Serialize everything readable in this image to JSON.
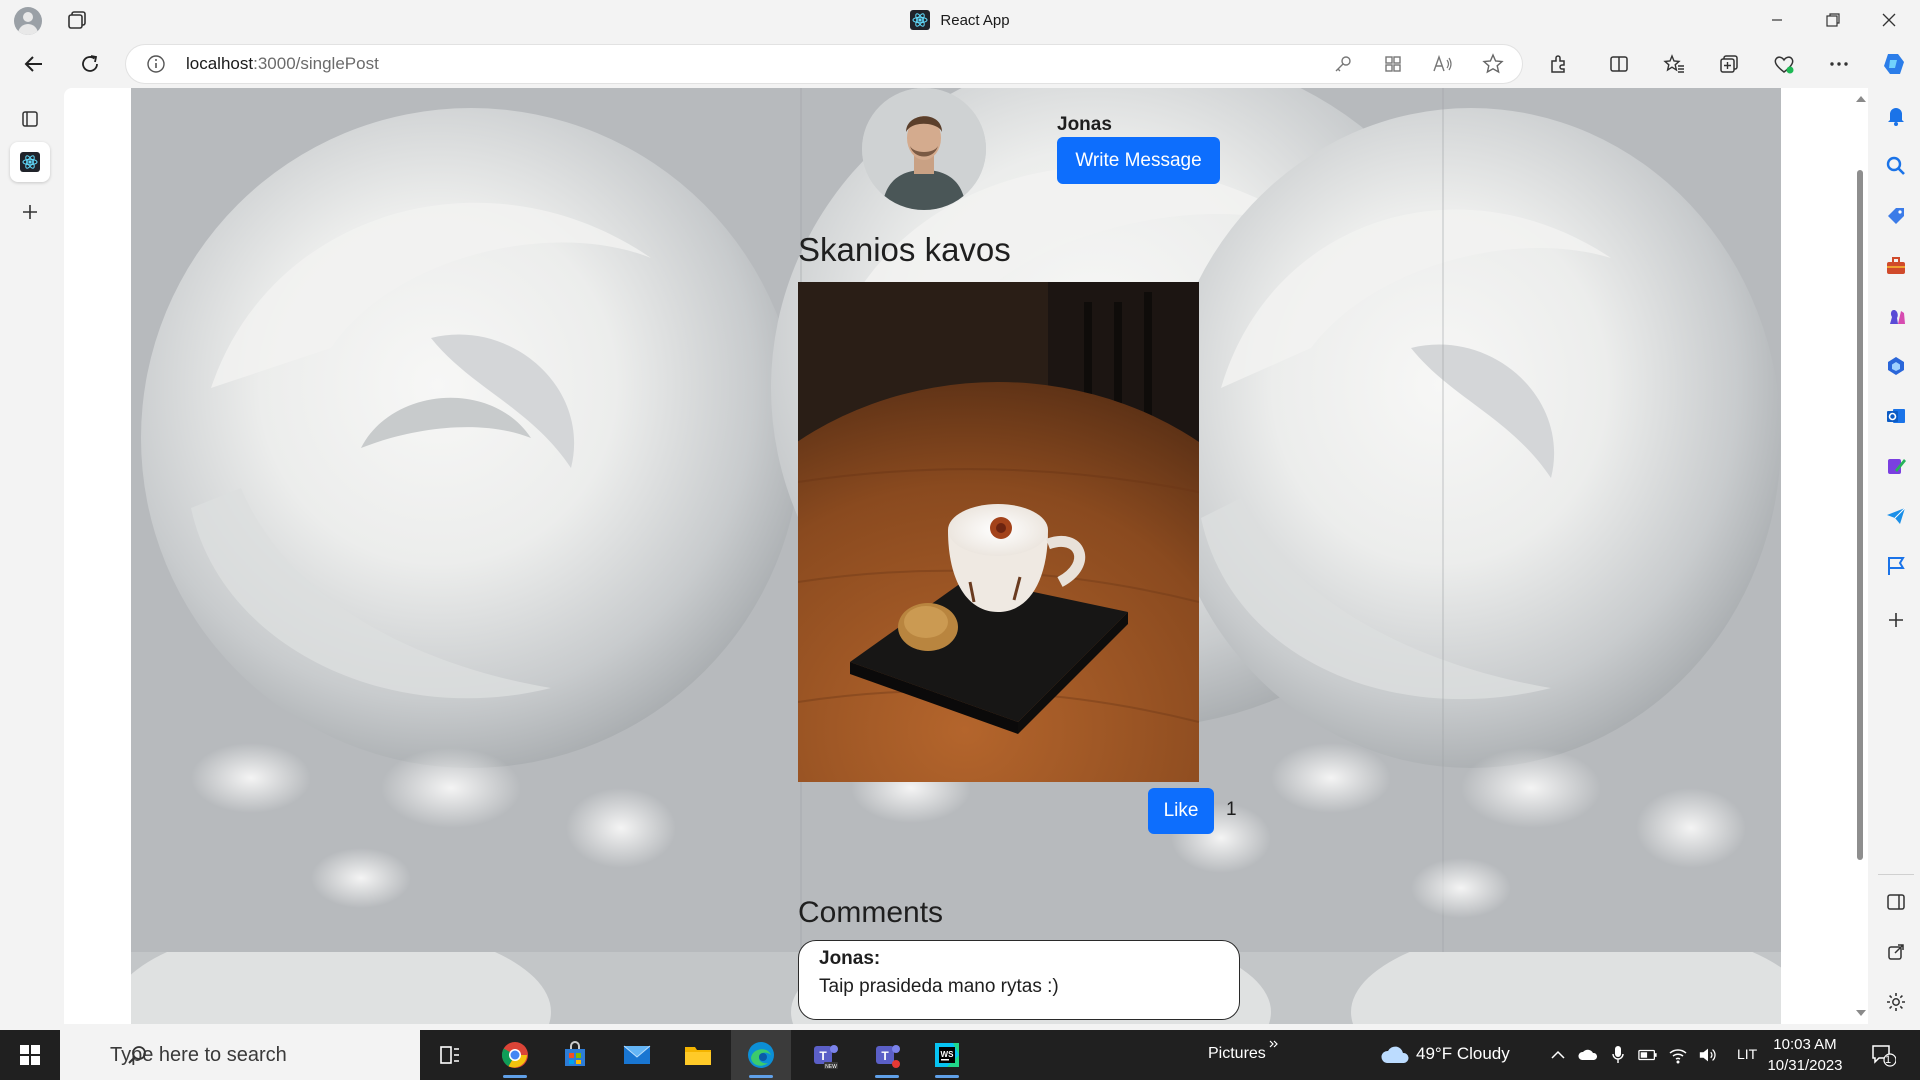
{
  "window": {
    "title": "React App"
  },
  "address_bar": {
    "url_host": "localhost",
    "url_path": ":3000/singlePost"
  },
  "post": {
    "author_name": "Jonas",
    "write_message_label": "Write Message",
    "title": "Skanios kavos",
    "like_label": "Like",
    "like_count": "1",
    "comments_title": "Comments",
    "comments": [
      {
        "author": "Jonas:",
        "text": "Taip prasideda mano rytas :)"
      }
    ]
  },
  "taskbar": {
    "search_placeholder": "Type here to search",
    "pictures_label": "Pictures",
    "weather": "49°F  Cloudy",
    "language": "LIT",
    "time": "10:03 AM",
    "date": "10/31/2023",
    "notification_count": "1"
  },
  "colors": {
    "accent": "#0d6efd",
    "background_rose": "#b9bcbf"
  }
}
